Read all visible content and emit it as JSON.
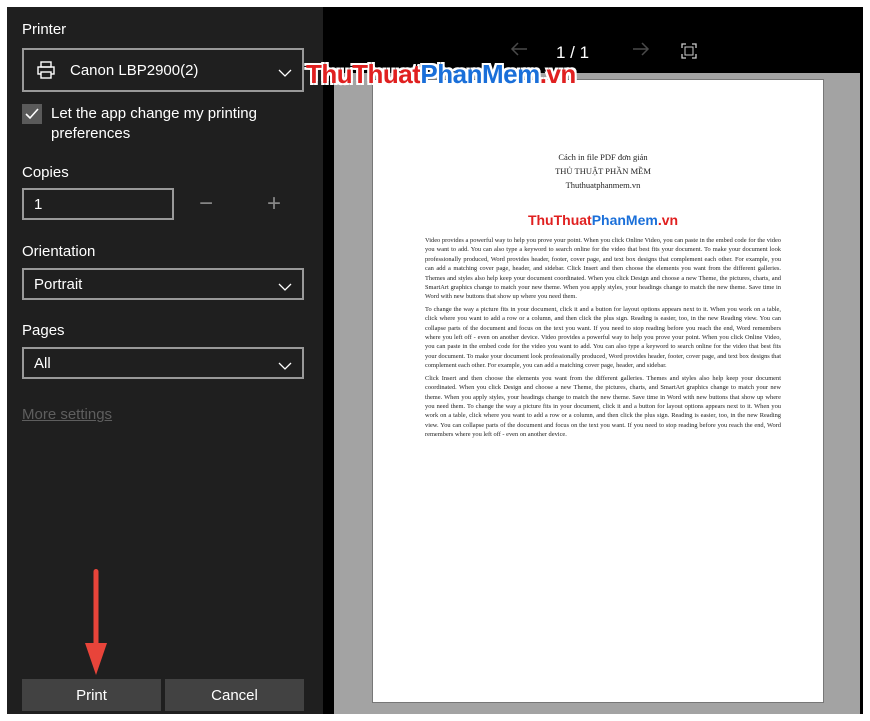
{
  "printer": {
    "label": "Printer",
    "selected": "Canon LBP2900(2)",
    "icon": "printer-icon"
  },
  "preferences": {
    "checked": true,
    "label": "Let the app change my printing preferences"
  },
  "copies": {
    "label": "Copies",
    "value": "1",
    "decrement": "−",
    "increment": "+"
  },
  "orientation": {
    "label": "Orientation",
    "selected": "Portrait"
  },
  "pages": {
    "label": "Pages",
    "selected": "All"
  },
  "more_settings": "More settings",
  "buttons": {
    "print": "Print",
    "cancel": "Cancel"
  },
  "preview_nav": {
    "page_indicator": "1 / 1",
    "prev_icon": "arrow-left-icon",
    "next_icon": "arrow-right-icon",
    "fullscreen_icon": "fullscreen-icon"
  },
  "watermark": {
    "part1": "ThuThuat",
    "part2": "PhanMem",
    "part3": ".vn"
  },
  "document": {
    "title_line1": "Cách in file PDF đơn giản",
    "title_line2": "THỦ THUẬT PHẦN MỀM",
    "title_line3": "Thuthuatphanmem.vn",
    "brand_part1": "ThuThuat",
    "brand_part2": "PhanMem",
    "brand_part3": ".vn",
    "paragraph1": "Video provides a powerful way to help you prove your point. When you click Online Video, you can paste in the embed code for the video you want to add. You can also type a keyword to search online for the video that best fits your document. To make your document look professionally produced, Word provides header, footer, cover page, and text box designs that complement each other. For example, you can add a matching cover page, header, and sidebar. Click Insert and then choose the elements you want from the different galleries. Themes and styles also help keep your document coordinated. When you click Design and choose a new Theme, the pictures, charts, and SmartArt graphics change to match your new theme. When you apply styles, your headings change to match the new theme. Save time in Word with new buttons that show up where you need them.",
    "paragraph2": "To change the way a picture fits in your document, click it and a button for layout options appears next to it. When you work on a table, click where you want to add a row or a column, and then click the plus sign. Reading is easier, too, in the new Reading view. You can collapse parts of the document and focus on the text you want. If you need to stop reading before you reach the end, Word remembers where you left off - even on another device. Video provides a powerful way to help you prove your point. When you click Online Video, you can paste in the embed code for the video you want to add. You can also type a keyword to search online for the video that best fits your document. To make your document look professionally produced, Word provides header, footer, cover page, and text box designs that complement each other. For example, you can add a matching cover page, header, and sidebar.",
    "paragraph3": "Click Insert and then choose the elements you want from the different galleries. Themes and styles also help keep your document coordinated. When you click Design and choose a new Theme, the pictures, charts, and SmartArt graphics change to match your new theme. When you apply styles, your headings change to match the new theme. Save time in Word with new buttons that show up where you need them. To change the way a picture fits in your document, click it and a button for layout options appears next to it. When you work on a table, click where you want to add a row or a column, and then click the plus sign. Reading is easier, too, in the new Reading view. You can collapse parts of the document and focus on the text you want. If you need to stop reading before you reach the end, Word remembers where you left off - even on another device."
  },
  "colors": {
    "panel_bg": "#1f1f1f",
    "preview_bg": "#a3a3a3",
    "accent_red": "#e8443a",
    "brand_red": "#e02020",
    "brand_blue": "#1a6fd9"
  }
}
